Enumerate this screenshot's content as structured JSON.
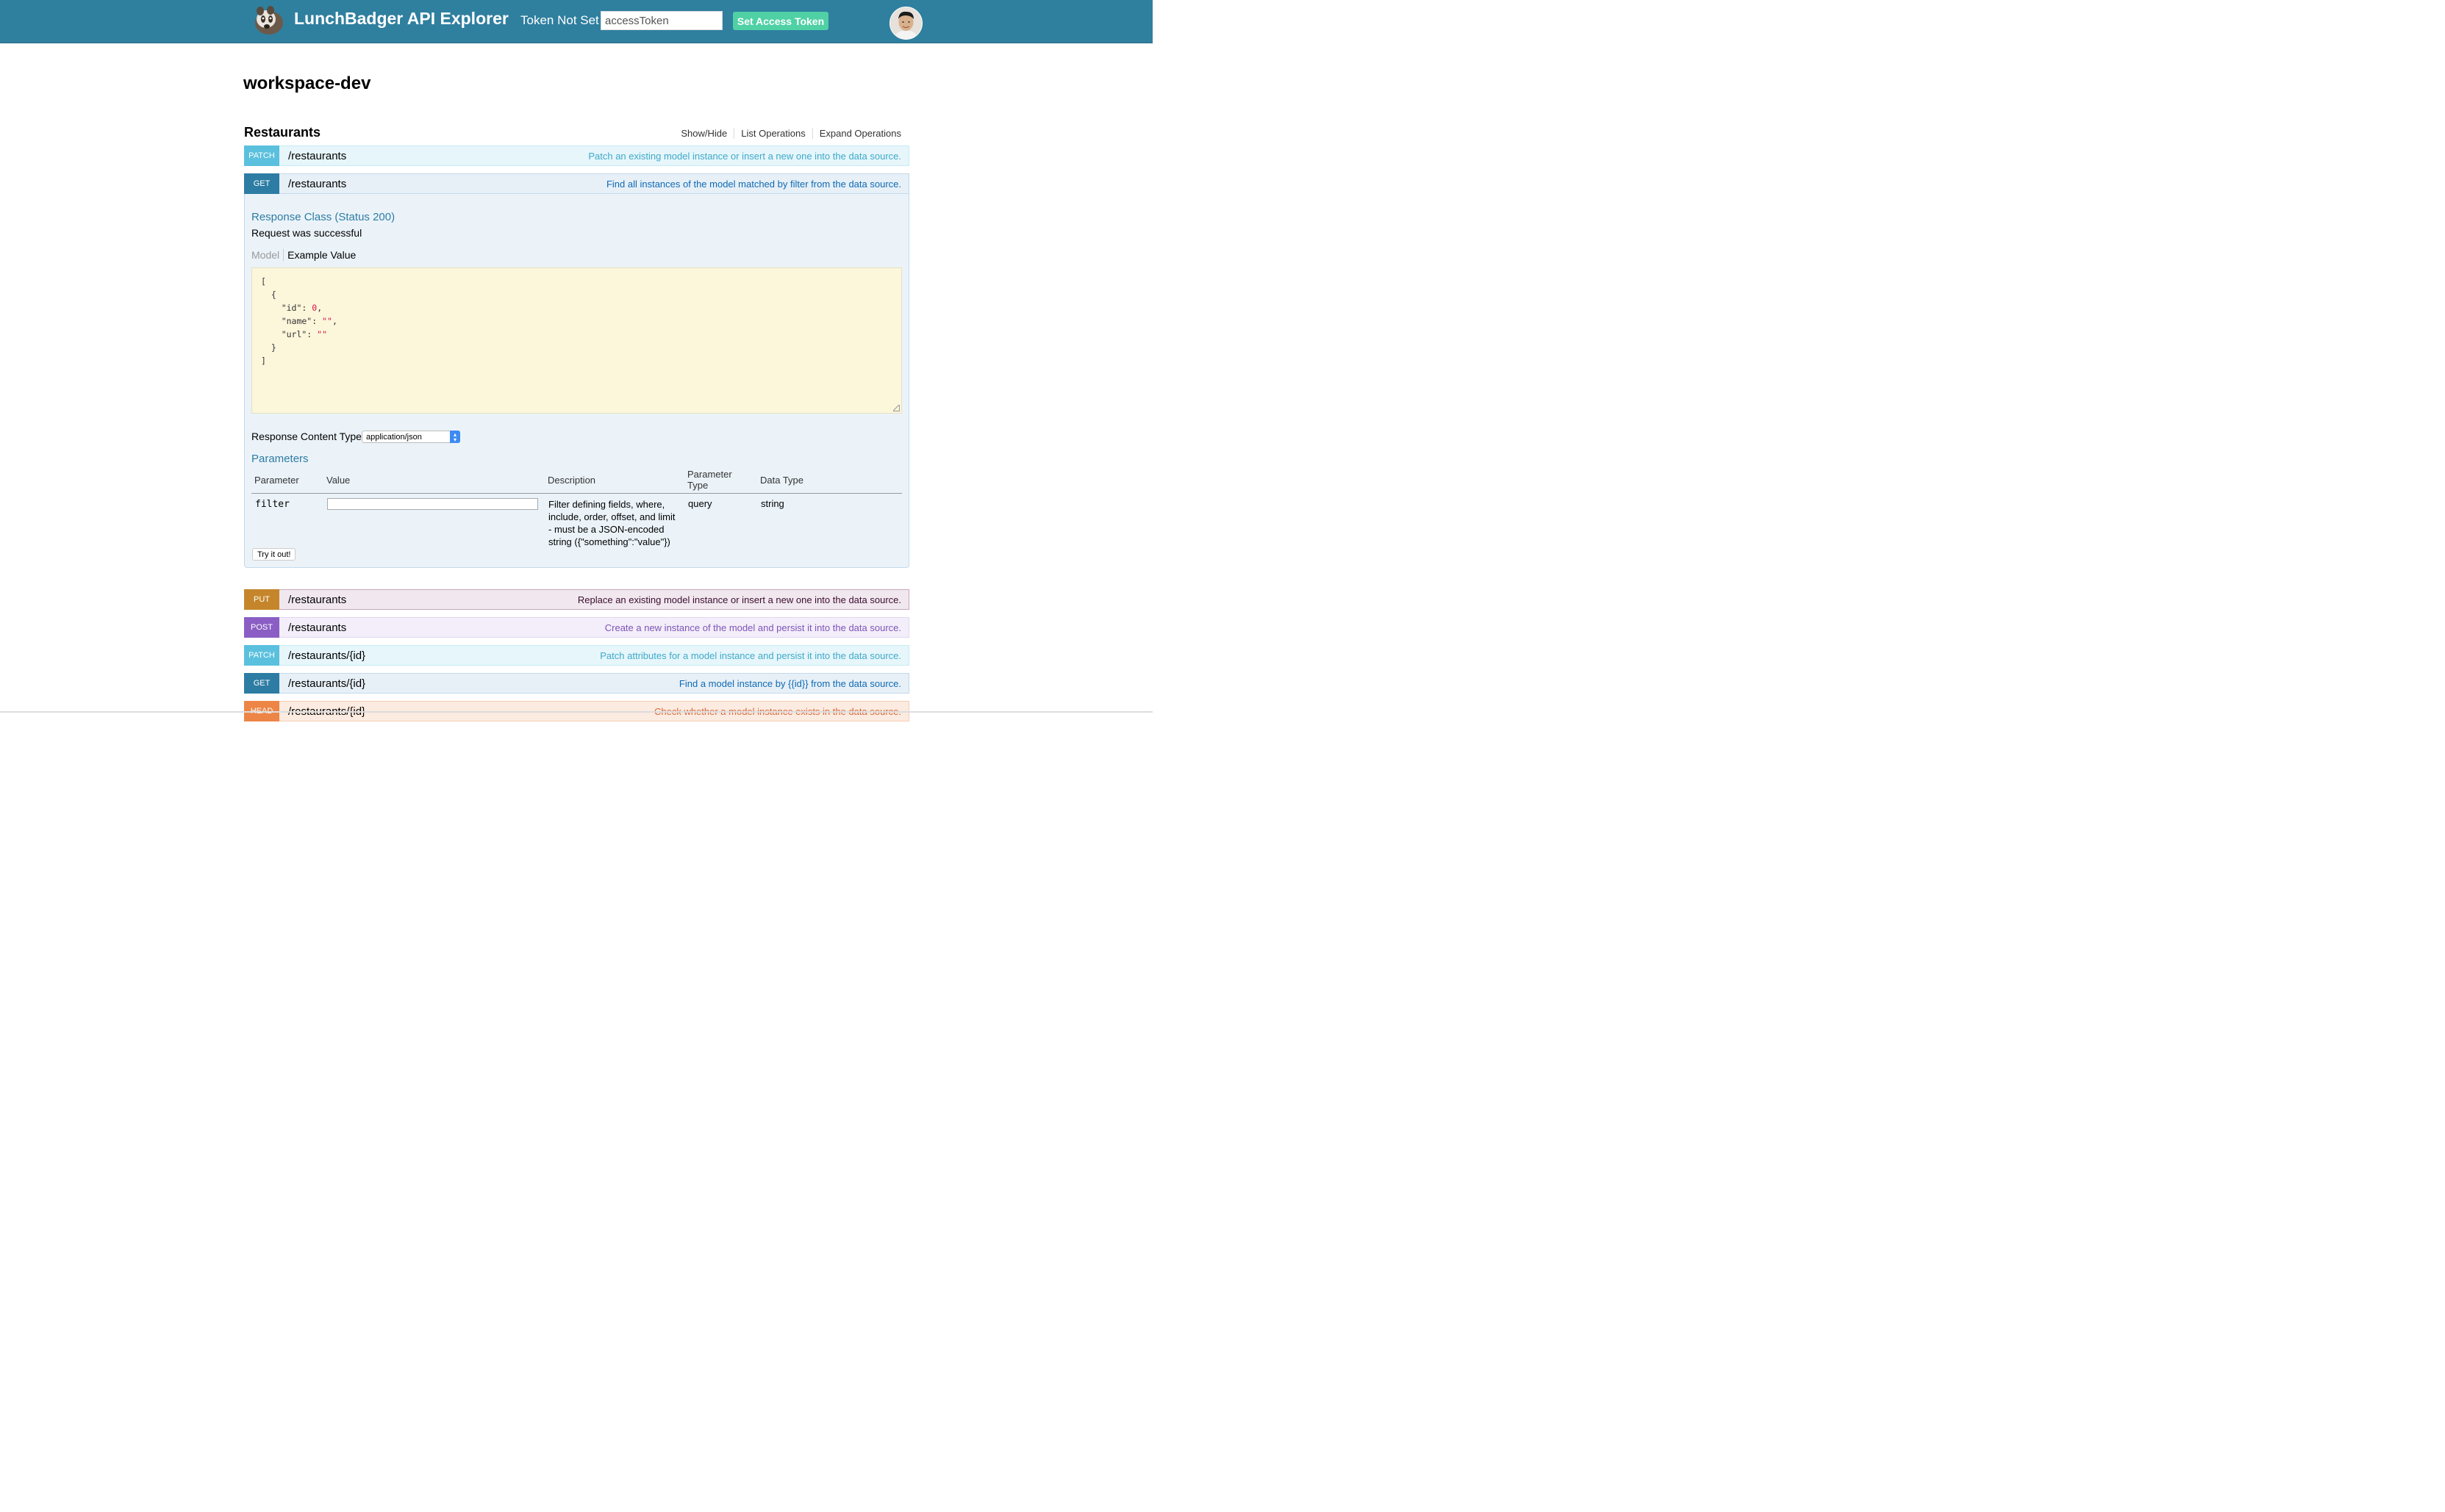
{
  "header": {
    "brand": "LunchBadger API Explorer",
    "token_status": "Token Not Set",
    "token_placeholder": "accessToken",
    "set_token_label": "Set Access Token"
  },
  "workspace_title": "workspace-dev",
  "resource": {
    "title": "Restaurants",
    "links": [
      "Show/Hide",
      "List Operations",
      "Expand Operations"
    ]
  },
  "operations": [
    {
      "method": "PATCH",
      "path": "/restaurants",
      "summary": "Patch an existing model instance or insert a new one into the data source."
    },
    {
      "method": "GET",
      "path": "/restaurants",
      "summary": "Find all instances of the model matched by filter from the data source."
    },
    {
      "method": "PUT",
      "path": "/restaurants",
      "summary": "Replace an existing model instance or insert a new one into the data source."
    },
    {
      "method": "POST",
      "path": "/restaurants",
      "summary": "Create a new instance of the model and persist it into the data source."
    },
    {
      "method": "PATCH",
      "path": "/restaurants/{id}",
      "summary": "Patch attributes for a model instance and persist it into the data source."
    },
    {
      "method": "GET",
      "path": "/restaurants/{id}",
      "summary": "Find a model instance by {{id}} from the data source."
    },
    {
      "method": "HEAD",
      "path": "/restaurants/{id}",
      "summary": "Check whether a model instance exists in the data source."
    }
  ],
  "expanded": {
    "response_class_title": "Response Class (Status 200)",
    "response_description": "Request was successful",
    "tab_model": "Model",
    "tab_example": "Example Value",
    "example_lines": [
      "[",
      "  {",
      "    \"id\": 0,",
      "    \"name\": \"\",",
      "    \"url\": \"\"",
      "  }",
      "]"
    ],
    "content_type_label": "Response Content Type",
    "content_type_value": "application/json",
    "parameters_title": "Parameters",
    "param_headers": [
      "Parameter",
      "Value",
      "Description",
      "Parameter Type",
      "Data Type"
    ],
    "param": {
      "name": "filter",
      "value": "",
      "description": "Filter defining fields, where, include, order, offset, and limit - must be a JSON-encoded string ({\"something\":\"value\"})",
      "param_type": "query",
      "data_type": "string"
    },
    "try_label": "Try it out!"
  }
}
